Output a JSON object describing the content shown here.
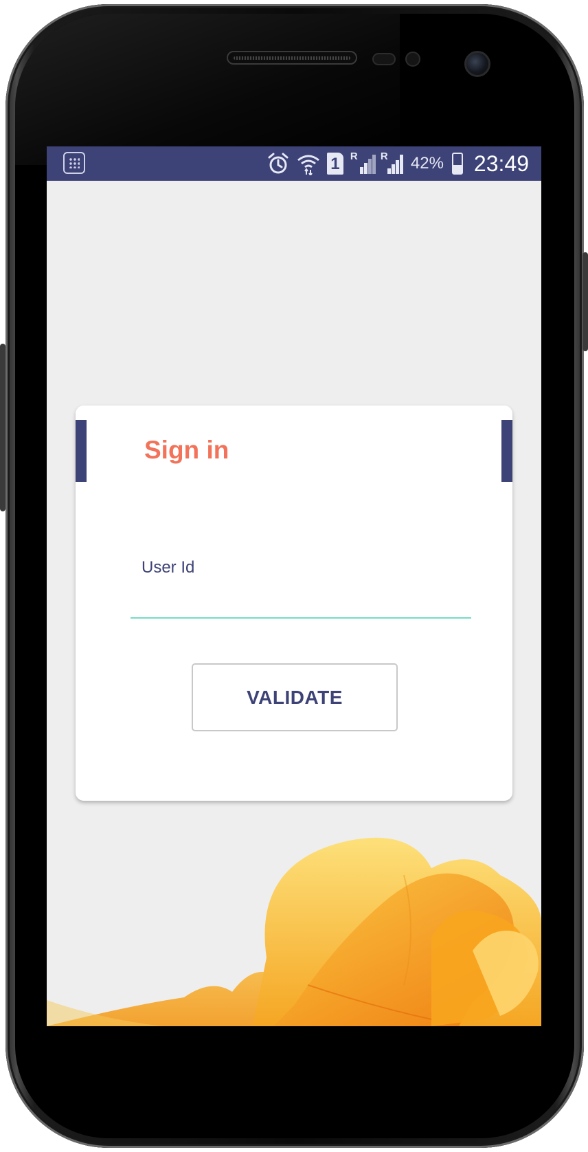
{
  "status_bar": {
    "battery_percent": "42%",
    "time": "23:49",
    "sim_slot": "1",
    "roaming_indicator_1": "R",
    "roaming_indicator_2": "R",
    "icons": [
      "app-grid-icon",
      "alarm-icon",
      "wifi-icon",
      "sim-card-icon",
      "signal-icon",
      "signal-icon",
      "battery-charging-icon"
    ]
  },
  "signin": {
    "title": "Sign in",
    "user_id_label": "User Id",
    "user_id_value": "",
    "validate_label": "VALIDATE"
  },
  "colors": {
    "primary": "#3d4277",
    "title_accent": "#f2735a",
    "input_underline": "#74dcc4",
    "background": "#eeeeee",
    "decor": "#f7b533"
  }
}
